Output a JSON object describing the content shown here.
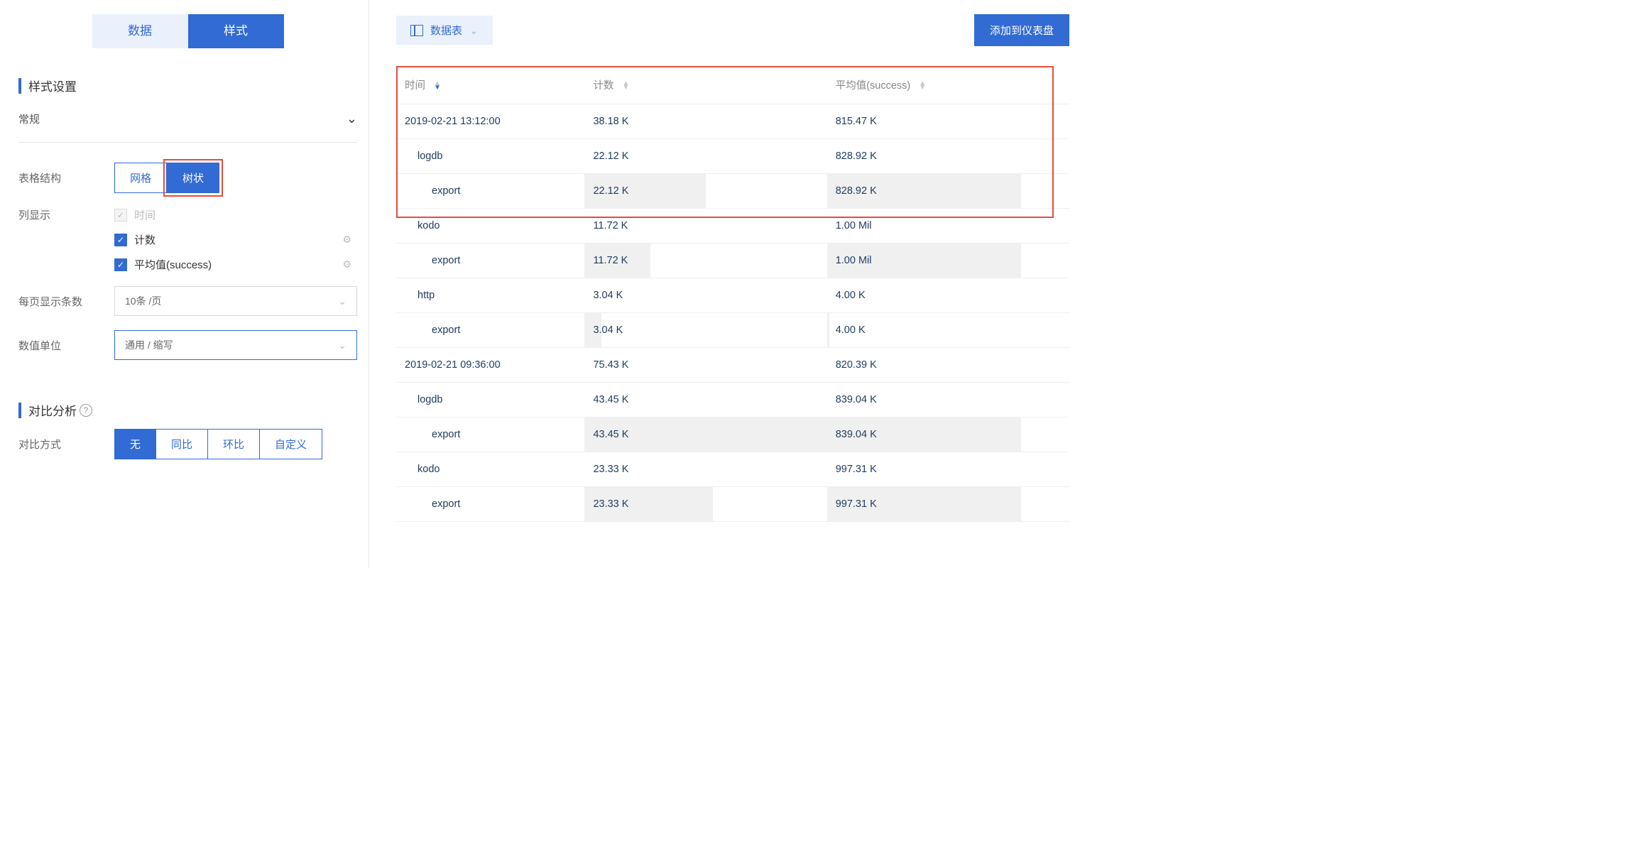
{
  "tabs": {
    "data": "数据",
    "style": "样式"
  },
  "sections": {
    "style_settings": "样式设置",
    "general": "常规",
    "compare_analysis": "对比分析"
  },
  "form": {
    "table_structure_label": "表格结构",
    "table_structure_grid": "网格",
    "table_structure_tree": "树状",
    "column_display_label": "列显示",
    "cb_time": "时间",
    "cb_count": "计数",
    "cb_avg": "平均值(success)",
    "per_page_label": "每页显示条数",
    "per_page_value": "10条 /页",
    "unit_label": "数值单位",
    "unit_value": "通用 / 缩写",
    "compare_label": "对比方式",
    "compare_none": "无",
    "compare_yoy": "同比",
    "compare_mom": "环比",
    "compare_custom": "自定义"
  },
  "right": {
    "view_label": "数据表",
    "add_btn": "添加到仪表盘"
  },
  "table": {
    "headers": {
      "time": "时间",
      "count": "计数",
      "avg": "平均值(success)"
    },
    "rows": [
      {
        "time": "2019-02-21 13:12:00",
        "indent": 0,
        "count": "38.18 K",
        "avg": "815.47 K",
        "barC": 0,
        "barA": 0
      },
      {
        "time": "logdb",
        "indent": 1,
        "count": "22.12 K",
        "avg": "828.92 K",
        "barC": 0,
        "barA": 0
      },
      {
        "time": "export",
        "indent": 2,
        "count": "22.12 K",
        "avg": "828.92 K",
        "barC": 50,
        "barA": 80
      },
      {
        "time": "kodo",
        "indent": 1,
        "count": "11.72 K",
        "avg": "1.00 Mil",
        "barC": 0,
        "barA": 0
      },
      {
        "time": "export",
        "indent": 2,
        "count": "11.72 K",
        "avg": "1.00 Mil",
        "barC": 27,
        "barA": 80
      },
      {
        "time": "http",
        "indent": 1,
        "count": "3.04 K",
        "avg": "4.00 K",
        "barC": 0,
        "barA": 0
      },
      {
        "time": "export",
        "indent": 2,
        "count": "3.04 K",
        "avg": "4.00 K",
        "barC": 7,
        "barA": 1
      },
      {
        "time": "2019-02-21 09:36:00",
        "indent": 0,
        "count": "75.43 K",
        "avg": "820.39 K",
        "barC": 0,
        "barA": 0
      },
      {
        "time": "logdb",
        "indent": 1,
        "count": "43.45 K",
        "avg": "839.04 K",
        "barC": 0,
        "barA": 0
      },
      {
        "time": "export",
        "indent": 2,
        "count": "43.45 K",
        "avg": "839.04 K",
        "barC": 100,
        "barA": 80
      },
      {
        "time": "kodo",
        "indent": 1,
        "count": "23.33 K",
        "avg": "997.31 K",
        "barC": 0,
        "barA": 0
      },
      {
        "time": "export",
        "indent": 2,
        "count": "23.33 K",
        "avg": "997.31 K",
        "barC": 53,
        "barA": 80
      }
    ]
  }
}
